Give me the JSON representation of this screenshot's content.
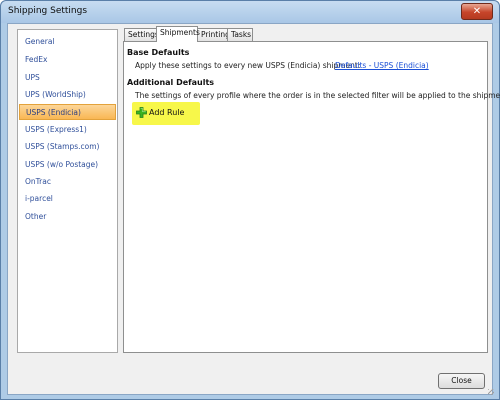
{
  "window": {
    "title": "Shipping Settings",
    "close_glyph": "✕"
  },
  "sidebar": {
    "items": [
      {
        "label": "General",
        "selected": false
      },
      {
        "label": "FedEx",
        "selected": false
      },
      {
        "label": "UPS",
        "selected": false
      },
      {
        "label": "UPS (WorldShip)",
        "selected": false
      },
      {
        "label": "USPS (Endicia)",
        "selected": true
      },
      {
        "label": "USPS (Express1)",
        "selected": false
      },
      {
        "label": "USPS (Stamps.com)",
        "selected": false
      },
      {
        "label": "USPS (w/o Postage)",
        "selected": false
      },
      {
        "label": "OnTrac",
        "selected": false
      },
      {
        "label": "i-parcel",
        "selected": false
      },
      {
        "label": "Other",
        "selected": false
      }
    ]
  },
  "tabs": [
    {
      "label": "Settings",
      "active": false
    },
    {
      "label": "Shipments",
      "active": true
    },
    {
      "label": "Printing",
      "active": false
    },
    {
      "label": "Tasks",
      "active": false
    }
  ],
  "shipments": {
    "base_defaults_title": "Base Defaults",
    "base_defaults_text": "Apply these settings to every new USPS (Endicia) shipment:",
    "base_defaults_link": "Defaults - USPS (Endicia)",
    "additional_defaults_title": "Additional Defaults",
    "additional_defaults_text": "The settings of every profile where the order is in the selected filter will be applied to the shipment.",
    "add_rule_label": "Add Rule",
    "add_rule_icon": "plus-icon"
  },
  "footer": {
    "close_label": "Close"
  },
  "colors": {
    "selected_item": "#f9b754",
    "link": "#1a4fd6",
    "highlight": "#f7f74a",
    "plus_icon": "#3cb521"
  }
}
